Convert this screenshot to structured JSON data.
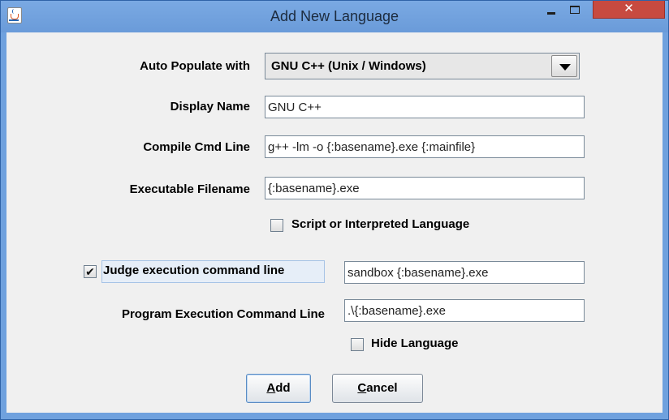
{
  "window": {
    "title": "Add New Language",
    "close_glyph": "✕",
    "icon": "java-coffee-cup-icon"
  },
  "form": {
    "auto_populate": {
      "label": "Auto Populate with",
      "selected": "GNU C++ (Unix / Windows)"
    },
    "display_name": {
      "label": "Display Name",
      "value": "GNU C++"
    },
    "compile_cmd": {
      "label": "Compile Cmd Line",
      "value": "g++ -lm -o {:basename}.exe {:mainfile}"
    },
    "executable": {
      "label": "Executable Filename",
      "value": "{:basename}.exe"
    },
    "script_interpreted": {
      "label": "Script or Interpreted Language",
      "checked": false
    },
    "judge_exec": {
      "label": "Judge execution command line",
      "checked": true,
      "value": "sandbox {:basename}.exe"
    },
    "program_exec": {
      "label": "Program Execution Command Line",
      "value": ".\\{:basename}.exe"
    },
    "hide_language": {
      "label": "Hide Language",
      "checked": false
    }
  },
  "buttons": {
    "add_mnemonic": "A",
    "add_rest": "dd",
    "cancel_mnemonic": "C",
    "cancel_rest": "ancel"
  },
  "glyphs": {
    "check": "✔"
  },
  "colors": {
    "titlebar": "#6fa1de",
    "close": "#c74a40",
    "client": "#f0f0f0"
  }
}
